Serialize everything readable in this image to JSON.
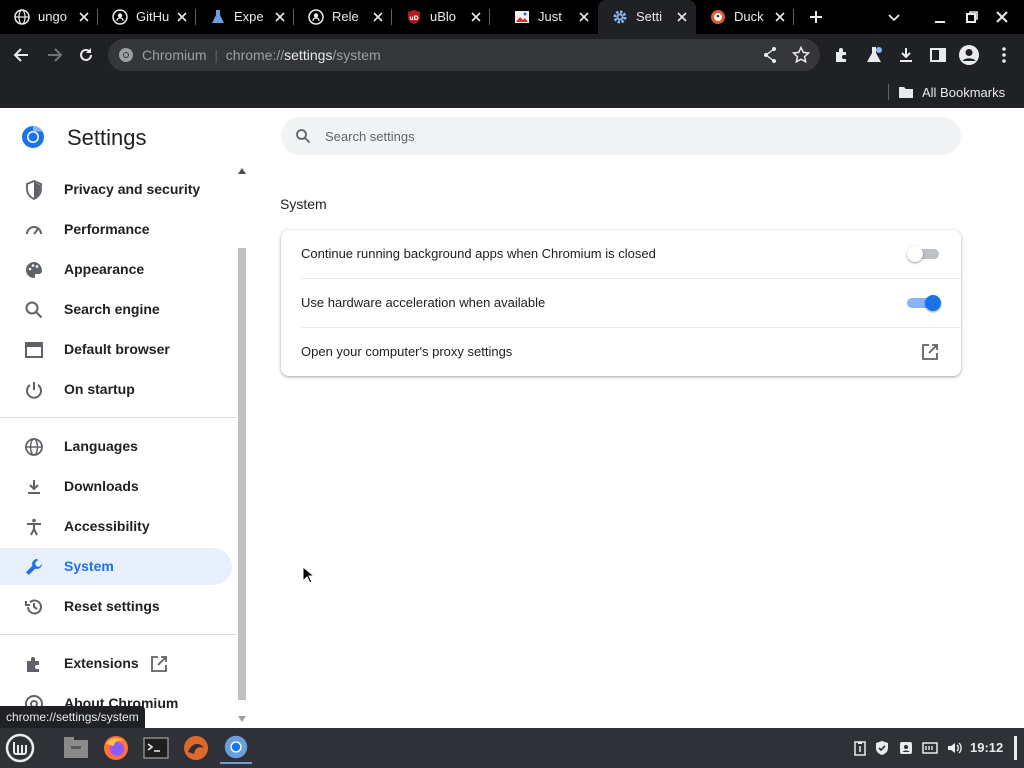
{
  "tabs": [
    {
      "label": "ungo",
      "icon": "globe-icon",
      "active": false
    },
    {
      "label": "GitHu",
      "icon": "github-icon",
      "active": false
    },
    {
      "label": "Expe",
      "icon": "flask-icon",
      "active": false
    },
    {
      "label": "Rele",
      "icon": "github-icon",
      "active": false
    },
    {
      "label": "uBlo",
      "icon": "ublock-icon",
      "active": false
    },
    {
      "label": "Just",
      "icon": "image-icon",
      "active": false
    },
    {
      "label": "Setti",
      "icon": "gear-icon",
      "active": true
    },
    {
      "label": "Duck",
      "icon": "duckduckgo-icon",
      "active": false
    }
  ],
  "omnibox": {
    "site_label": "Chromium",
    "url_prefix": "chrome://",
    "url_host": "settings",
    "url_path": "/system"
  },
  "bookmarks": {
    "all_label": "All Bookmarks"
  },
  "settings": {
    "title": "Settings",
    "search_placeholder": "Search settings",
    "nav": [
      {
        "label": "Privacy and security",
        "icon": "shield-icon"
      },
      {
        "label": "Performance",
        "icon": "speedometer-icon"
      },
      {
        "label": "Appearance",
        "icon": "palette-icon"
      },
      {
        "label": "Search engine",
        "icon": "search-icon"
      },
      {
        "label": "Default browser",
        "icon": "browser-window-icon"
      },
      {
        "label": "On startup",
        "icon": "power-icon"
      },
      {
        "label": "Languages",
        "icon": "globe-icon"
      },
      {
        "label": "Downloads",
        "icon": "download-icon"
      },
      {
        "label": "Accessibility",
        "icon": "accessibility-icon"
      },
      {
        "label": "System",
        "icon": "wrench-icon",
        "selected": true
      },
      {
        "label": "Reset settings",
        "icon": "history-icon"
      },
      {
        "label": "Extensions",
        "icon": "puzzle-icon"
      },
      {
        "label": "About Chromium",
        "icon": "chromium-icon"
      }
    ],
    "section_title": "System",
    "rows": [
      {
        "label": "Continue running background apps when Chromium is closed",
        "control": "toggle",
        "checked": false
      },
      {
        "label": "Use hardware acceleration when available",
        "control": "toggle",
        "checked": true
      },
      {
        "label": "Open your computer's proxy settings",
        "control": "external-link"
      }
    ]
  },
  "status_tooltip": "chrome://settings/system",
  "taskbar": {
    "apps": [
      "mint-menu-icon",
      "files-icon",
      "firefox-icon",
      "terminal-icon",
      "fox-app-icon",
      "chromium-icon"
    ],
    "clock": "19:12"
  },
  "colors": {
    "accent": "#1a73e8",
    "selected_nav_bg": "#e8f0fe",
    "toolbar_bg": "#202124"
  }
}
